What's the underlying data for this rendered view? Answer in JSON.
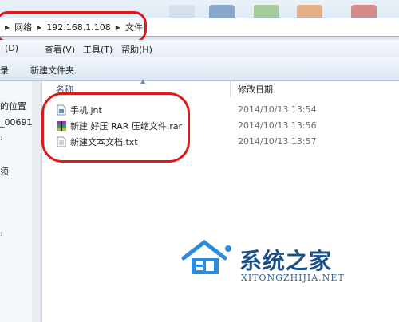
{
  "address": {
    "crumbs": [
      "网络",
      "192.168.1.108",
      "文件"
    ]
  },
  "menu": {
    "items": [
      "(D)",
      "查看(V)",
      "工具(T)",
      "帮助(H)"
    ]
  },
  "toolbar": {
    "left_fragment": "录",
    "new_folder": "新建文件夹"
  },
  "nav": {
    "items": [
      "的位置",
      "_00691",
      "须"
    ]
  },
  "columns": {
    "name": "名称",
    "modified": "修改日期"
  },
  "files": [
    {
      "name": "手机.jnt",
      "date": "2014/10/13 13:54",
      "icon": "jnt-file-icon"
    },
    {
      "name": "新建 好压 RAR 压缩文件.rar",
      "date": "2014/10/13 13:56",
      "icon": "rar-archive-icon"
    },
    {
      "name": "新建文本文档.txt",
      "date": "2014/10/13 13:57",
      "icon": "text-file-icon"
    }
  ],
  "watermark": {
    "title": "系统之家",
    "site": "XITONGZHIJIA.NET"
  },
  "colors": {
    "highlight_oval": "#e01818",
    "watermark_blue": "#1a4f8a"
  }
}
